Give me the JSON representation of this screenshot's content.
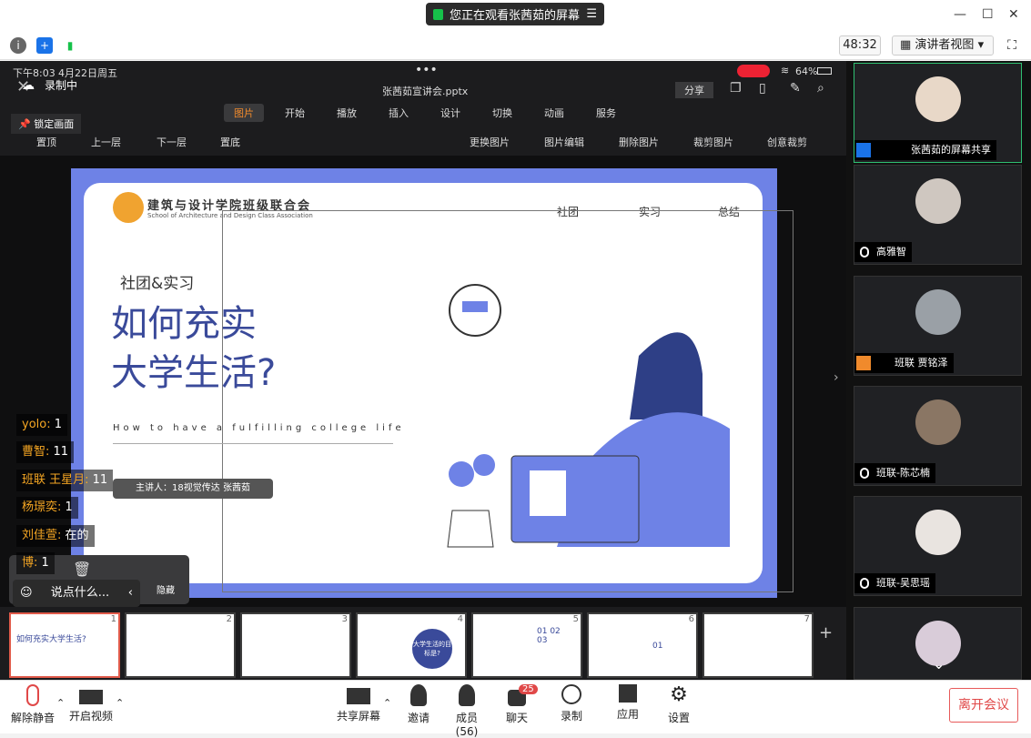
{
  "window": {
    "share_banner": "您正在观看张茜茹的屏幕",
    "timer": "48:32",
    "view_mode": "演讲者视图"
  },
  "ipad": {
    "time": "下午8:03",
    "date": "4月22日周五",
    "battery": "64%",
    "file_name": "张茜茹宣讲会.pptx",
    "share_label": "分享",
    "recording": "录制中",
    "lock_tip": "锁定画面",
    "tabs": [
      "图片",
      "开始",
      "播放",
      "插入",
      "设计",
      "切换",
      "动画",
      "服务"
    ],
    "tools": [
      "置顶",
      "上一层",
      "下一层",
      "置底",
      "更换图片",
      "图片编辑",
      "删除图片",
      "裁剪图片",
      "创意裁剪"
    ],
    "edit_tools": [
      "隐藏"
    ]
  },
  "slide": {
    "org_name": "建筑与设计学院班级联合会",
    "org_name_en": "School of Architecture and Design Class Association",
    "nav": [
      "社团",
      "实习",
      "总结"
    ],
    "subtitle": "社团&实习",
    "title1": "如何充实",
    "title2": "大学生活?",
    "tagline": "How to have a fulfilling college life",
    "speaker": "主讲人：18视觉传达 张茜茹"
  },
  "thumbnails": [
    {
      "n": "1",
      "t": "如何充实大学生活?"
    },
    {
      "n": "2",
      "t": ""
    },
    {
      "n": "3",
      "t": ""
    },
    {
      "n": "4",
      "t": "大学生活的目标是?"
    },
    {
      "n": "5",
      "t": "01 02 03"
    },
    {
      "n": "6",
      "t": "01"
    },
    {
      "n": "7",
      "t": ""
    }
  ],
  "chat": [
    {
      "user": "yolo:",
      "msg": " 1"
    },
    {
      "user": "曹智:",
      "msg": " 11"
    },
    {
      "user": "班联 王星月:",
      "msg": " 11"
    },
    {
      "user": "杨璟奕:",
      "msg": " 1"
    },
    {
      "user": "刘佳萱:",
      "msg": " 在的"
    },
    {
      "user": "博:",
      "msg": " 1"
    }
  ],
  "chat_input": "说点什么...",
  "participants": [
    {
      "name": "张茜茹的屏幕共享"
    },
    {
      "name": "高雅智"
    },
    {
      "name": "班联 贾铭泽"
    },
    {
      "name": "班联-陈芯楠"
    },
    {
      "name": "班联-吴思瑶"
    },
    {
      "name": ""
    }
  ],
  "bottom": {
    "mute": "解除静音",
    "video": "开启视频",
    "share": "共享屏幕",
    "invite": "邀请",
    "members": "成员(56)",
    "chat": "聊天",
    "chat_badge": "25",
    "record": "录制",
    "apps": "应用",
    "settings": "设置",
    "leave": "离开会议"
  },
  "colors": {
    "slide_blue": "#6e82e6",
    "title_blue": "#3a4a9a",
    "leave_red": "#e04848",
    "highlight_green": "#2fbf71"
  }
}
